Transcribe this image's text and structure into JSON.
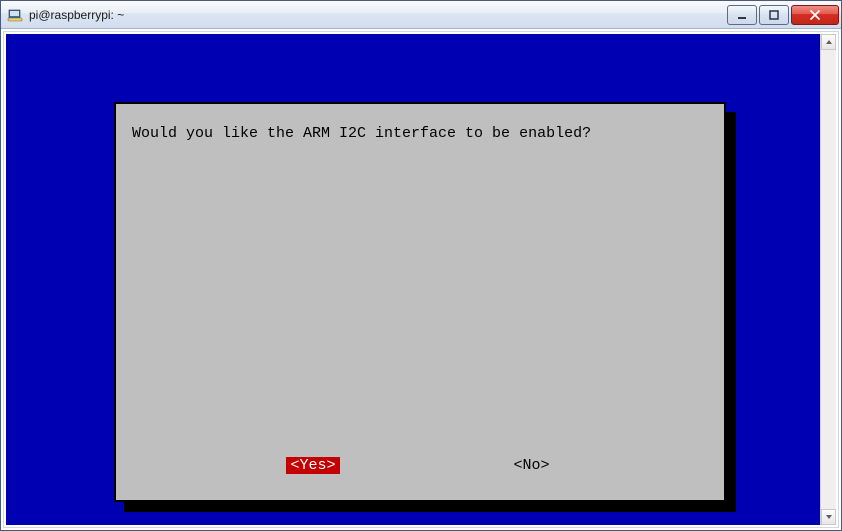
{
  "window": {
    "title": "pi@raspberrypi: ~"
  },
  "terminal": {
    "bg": "#0000b3"
  },
  "dialog": {
    "message": "Would you like the ARM I2C interface to be enabled?",
    "yes": "<Yes>",
    "no": "<No>",
    "selected": "yes"
  }
}
